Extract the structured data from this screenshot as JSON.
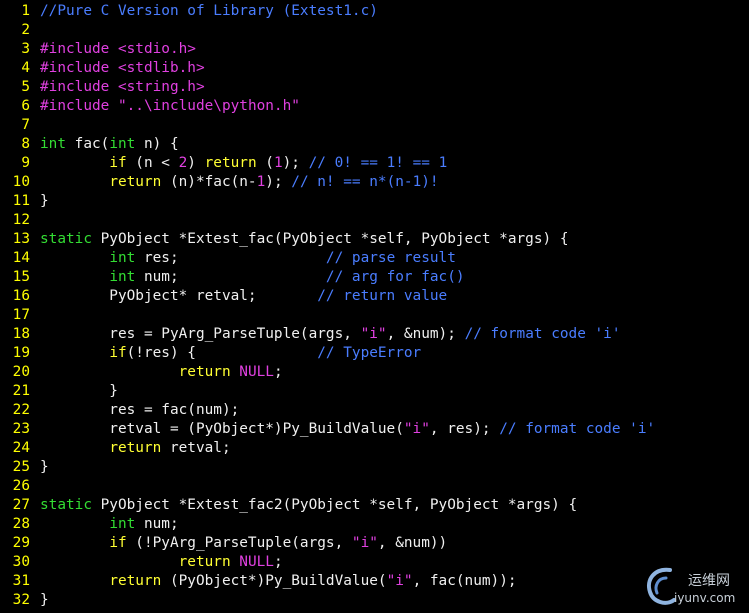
{
  "editor": {
    "lines": [
      {
        "n": "1",
        "t": [
          {
            "c": "comment",
            "s": "//Pure C Version of Library (Extest1.c)"
          }
        ]
      },
      {
        "n": "2",
        "t": []
      },
      {
        "n": "3",
        "t": [
          {
            "c": "pre",
            "s": "#include "
          },
          {
            "c": "str",
            "s": "<stdio.h>"
          }
        ]
      },
      {
        "n": "4",
        "t": [
          {
            "c": "pre",
            "s": "#include "
          },
          {
            "c": "str",
            "s": "<stdlib.h>"
          }
        ]
      },
      {
        "n": "5",
        "t": [
          {
            "c": "pre",
            "s": "#include "
          },
          {
            "c": "str",
            "s": "<string.h>"
          }
        ]
      },
      {
        "n": "6",
        "t": [
          {
            "c": "pre",
            "s": "#include "
          },
          {
            "c": "str",
            "s": "\"..\\include\\python.h\""
          }
        ]
      },
      {
        "n": "7",
        "t": []
      },
      {
        "n": "8",
        "t": [
          {
            "c": "type",
            "s": "int"
          },
          {
            "c": "plain",
            "s": " fac("
          },
          {
            "c": "type",
            "s": "int"
          },
          {
            "c": "plain",
            "s": " n) {"
          }
        ]
      },
      {
        "n": "9",
        "t": [
          {
            "c": "plain",
            "s": "        "
          },
          {
            "c": "kw",
            "s": "if"
          },
          {
            "c": "plain",
            "s": " (n < "
          },
          {
            "c": "num",
            "s": "2"
          },
          {
            "c": "plain",
            "s": ") "
          },
          {
            "c": "kw",
            "s": "return"
          },
          {
            "c": "plain",
            "s": " ("
          },
          {
            "c": "num",
            "s": "1"
          },
          {
            "c": "plain",
            "s": "); "
          },
          {
            "c": "comment",
            "s": "// 0! == 1! == 1"
          }
        ]
      },
      {
        "n": "10",
        "t": [
          {
            "c": "plain",
            "s": "        "
          },
          {
            "c": "kw",
            "s": "return"
          },
          {
            "c": "plain",
            "s": " (n)*fac(n-"
          },
          {
            "c": "num",
            "s": "1"
          },
          {
            "c": "plain",
            "s": "); "
          },
          {
            "c": "comment",
            "s": "// n! == n*(n-1)!"
          }
        ]
      },
      {
        "n": "11",
        "t": [
          {
            "c": "plain",
            "s": "}"
          }
        ]
      },
      {
        "n": "12",
        "t": []
      },
      {
        "n": "13",
        "t": [
          {
            "c": "type",
            "s": "static"
          },
          {
            "c": "plain",
            "s": " PyObject *Extest_fac(PyObject *self, PyObject *args) {"
          }
        ]
      },
      {
        "n": "14",
        "t": [
          {
            "c": "plain",
            "s": "        "
          },
          {
            "c": "type",
            "s": "int"
          },
          {
            "c": "plain",
            "s": " res;                 "
          },
          {
            "c": "comment",
            "s": "// parse result"
          }
        ]
      },
      {
        "n": "15",
        "t": [
          {
            "c": "plain",
            "s": "        "
          },
          {
            "c": "type",
            "s": "int"
          },
          {
            "c": "plain",
            "s": " num;                 "
          },
          {
            "c": "comment",
            "s": "// arg for fac()"
          }
        ]
      },
      {
        "n": "16",
        "t": [
          {
            "c": "plain",
            "s": "        PyObject* retval;       "
          },
          {
            "c": "comment",
            "s": "// return value"
          }
        ]
      },
      {
        "n": "17",
        "t": []
      },
      {
        "n": "18",
        "t": [
          {
            "c": "plain",
            "s": "        res = PyArg_ParseTuple(args, "
          },
          {
            "c": "str",
            "s": "\"i\""
          },
          {
            "c": "plain",
            "s": ", &num); "
          },
          {
            "c": "comment",
            "s": "// format code 'i'"
          }
        ]
      },
      {
        "n": "19",
        "t": [
          {
            "c": "plain",
            "s": "        "
          },
          {
            "c": "kw",
            "s": "if"
          },
          {
            "c": "plain",
            "s": "(!res) {              "
          },
          {
            "c": "comment",
            "s": "// TypeError"
          }
        ]
      },
      {
        "n": "20",
        "t": [
          {
            "c": "plain",
            "s": "                "
          },
          {
            "c": "kw",
            "s": "return"
          },
          {
            "c": "plain",
            "s": " "
          },
          {
            "c": "num",
            "s": "NULL"
          },
          {
            "c": "plain",
            "s": ";"
          }
        ]
      },
      {
        "n": "21",
        "t": [
          {
            "c": "plain",
            "s": "        }"
          }
        ]
      },
      {
        "n": "22",
        "t": [
          {
            "c": "plain",
            "s": "        res = fac(num);"
          }
        ]
      },
      {
        "n": "23",
        "t": [
          {
            "c": "plain",
            "s": "        retval = (PyObject*)Py_BuildValue("
          },
          {
            "c": "str",
            "s": "\"i\""
          },
          {
            "c": "plain",
            "s": ", res); "
          },
          {
            "c": "comment",
            "s": "// format code 'i'"
          }
        ]
      },
      {
        "n": "24",
        "t": [
          {
            "c": "plain",
            "s": "        "
          },
          {
            "c": "kw",
            "s": "return"
          },
          {
            "c": "plain",
            "s": " retval;"
          }
        ]
      },
      {
        "n": "25",
        "t": [
          {
            "c": "plain",
            "s": "}"
          }
        ]
      },
      {
        "n": "26",
        "t": []
      },
      {
        "n": "27",
        "t": [
          {
            "c": "type",
            "s": "static"
          },
          {
            "c": "plain",
            "s": " PyObject *Extest_fac2(PyObject *self, PyObject *args) {"
          }
        ]
      },
      {
        "n": "28",
        "t": [
          {
            "c": "plain",
            "s": "        "
          },
          {
            "c": "type",
            "s": "int"
          },
          {
            "c": "plain",
            "s": " num;"
          }
        ]
      },
      {
        "n": "29",
        "t": [
          {
            "c": "plain",
            "s": "        "
          },
          {
            "c": "kw",
            "s": "if"
          },
          {
            "c": "plain",
            "s": " (!PyArg_ParseTuple(args, "
          },
          {
            "c": "str",
            "s": "\"i\""
          },
          {
            "c": "plain",
            "s": ", &num))"
          }
        ]
      },
      {
        "n": "30",
        "t": [
          {
            "c": "plain",
            "s": "                "
          },
          {
            "c": "kw",
            "s": "return"
          },
          {
            "c": "plain",
            "s": " "
          },
          {
            "c": "num",
            "s": "NULL"
          },
          {
            "c": "plain",
            "s": ";"
          }
        ]
      },
      {
        "n": "31",
        "t": [
          {
            "c": "plain",
            "s": "        "
          },
          {
            "c": "kw",
            "s": "return"
          },
          {
            "c": "plain",
            "s": " (PyObject*)Py_BuildValue("
          },
          {
            "c": "str",
            "s": "\"i\""
          },
          {
            "c": "plain",
            "s": ", fac(num));"
          }
        ]
      },
      {
        "n": "32",
        "t": [
          {
            "c": "plain",
            "s": "}"
          }
        ]
      }
    ]
  },
  "watermark": {
    "name": "运维网",
    "url": "iyunv.com",
    "icon": "swirl-logo"
  },
  "colors": {
    "background": "#000000",
    "line_number": "#ffff00",
    "comment": "#4a7dff",
    "preprocessor": "#e040e0",
    "type": "#33dd33",
    "keyword": "#ffff33",
    "text": "#f0f0f0"
  }
}
